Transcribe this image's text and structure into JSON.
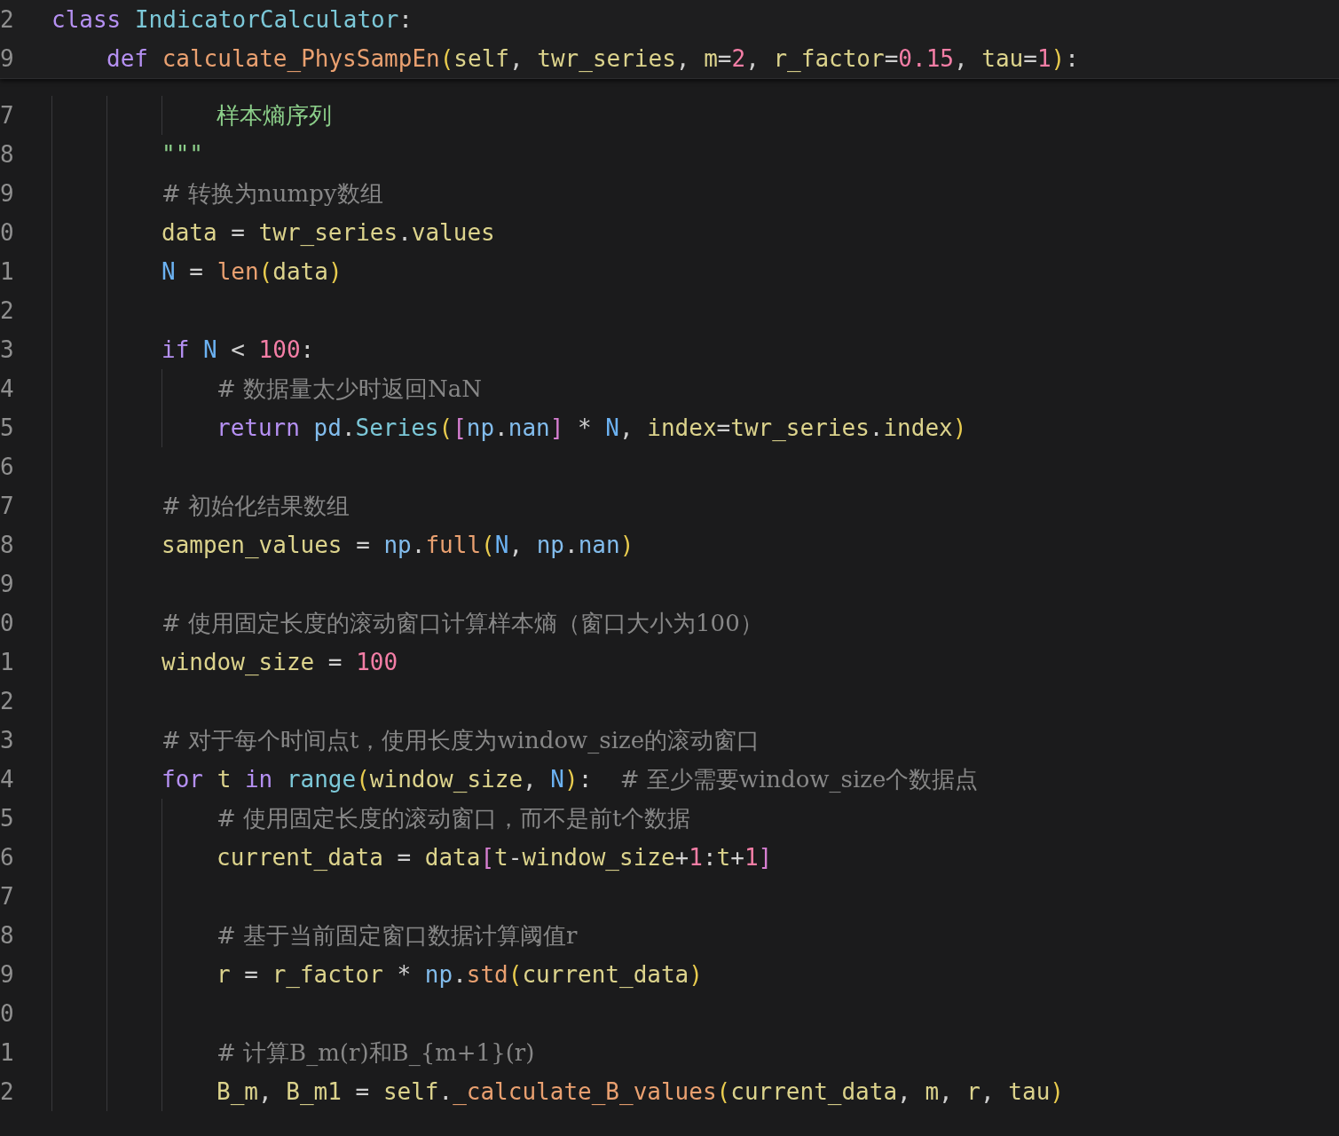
{
  "sticky_lines": [
    {
      "number": "2",
      "kind": "class",
      "text": "class IndicatorCalculator:"
    },
    {
      "number": "9",
      "kind": "method",
      "text": "def calculate_PhysSampEn(self, twr_series, m=2, r_factor=0.15, tau=1):"
    }
  ],
  "lines": [
    {
      "number": "7",
      "kind": "docstring_nested",
      "text": "样本熵序列"
    },
    {
      "number": "8",
      "kind": "docstring",
      "text": "\"\"\""
    },
    {
      "number": "9",
      "kind": "code",
      "text": "# 转换为numpy数组"
    },
    {
      "number": "0",
      "kind": "code",
      "text": "data = twr_series.values"
    },
    {
      "number": "1",
      "kind": "code",
      "text": "N = len(data)"
    },
    {
      "number": "2",
      "kind": "blank"
    },
    {
      "number": "3",
      "kind": "code",
      "text": "if N < 100:"
    },
    {
      "number": "4",
      "kind": "code_nested",
      "text": "# 数据量太少时返回NaN"
    },
    {
      "number": "5",
      "kind": "code_nested",
      "text": "return pd.Series([np.nan] * N, index=twr_series.index)"
    },
    {
      "number": "6",
      "kind": "blank"
    },
    {
      "number": "7",
      "kind": "code",
      "text": "# 初始化结果数组"
    },
    {
      "number": "8",
      "kind": "code",
      "text": "sampen_values = np.full(N, np.nan)"
    },
    {
      "number": "9",
      "kind": "blank"
    },
    {
      "number": "0",
      "kind": "code",
      "text": "# 使用固定长度的滚动窗口计算样本熵（窗口大小为100）"
    },
    {
      "number": "1",
      "kind": "code",
      "text": "window_size = 100"
    },
    {
      "number": "2",
      "kind": "blank"
    },
    {
      "number": "3",
      "kind": "code",
      "text": "# 对于每个时间点t，使用长度为window_size的滚动窗口"
    },
    {
      "number": "4",
      "kind": "code",
      "text": "for t in range(window_size, N):  # 至少需要window_size个数据点"
    },
    {
      "number": "5",
      "kind": "code_nested",
      "text": "# 使用固定长度的滚动窗口，而不是前t个数据"
    },
    {
      "number": "6",
      "kind": "code_nested",
      "text": "current_data = data[t-window_size+1:t+1]"
    },
    {
      "number": "7",
      "kind": "blank_nested"
    },
    {
      "number": "8",
      "kind": "code_nested",
      "text": "# 基于当前固定窗口数据计算阈值r"
    },
    {
      "number": "9",
      "kind": "code_nested",
      "text": "r = r_factor * np.std(current_data)"
    },
    {
      "number": "0",
      "kind": "blank_nested"
    },
    {
      "number": "1",
      "kind": "code_nested",
      "text": "# 计算B_m(r)和B_{m+1}(r)"
    },
    {
      "number": "2",
      "kind": "code_nested",
      "text": "B_m, B_m1 = self._calculate_B_values(current_data, m, r, tau)"
    }
  ]
}
